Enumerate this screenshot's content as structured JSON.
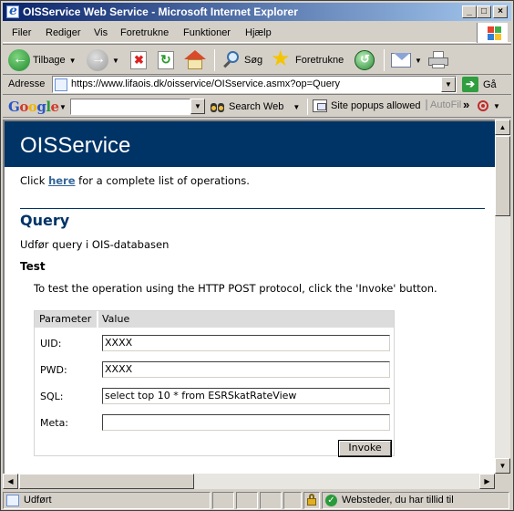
{
  "window": {
    "title": "OISService Web Service - Microsoft Internet Explorer",
    "controls": [
      "_",
      "□",
      "×"
    ]
  },
  "menu": [
    {
      "label": "Filer"
    },
    {
      "label": "Rediger"
    },
    {
      "label": "Vis"
    },
    {
      "label": "Foretrukne"
    },
    {
      "label": "Funktioner"
    },
    {
      "label": "Hjælp"
    }
  ],
  "toolbar": {
    "back_label": "Tilbage",
    "search_label": "Søg",
    "favorites_label": "Foretrukne"
  },
  "address": {
    "label": "Adresse",
    "url": "https://www.lifaois.dk/oisservice/OISservice.asmx?op=Query",
    "go_label": "Gå"
  },
  "google": {
    "logo": "Google",
    "search_value": "",
    "search_web_label": "Search Web",
    "popups_label": "Site popups allowed",
    "autofill_label": "AutoFill",
    "more": "»"
  },
  "page": {
    "header_title": "OISService",
    "intro_prefix": "Click ",
    "intro_link": "here",
    "intro_suffix": " for a complete list of operations.",
    "section_title": "Query",
    "section_desc": "Udfør query i OIS-databasen",
    "test_title": "Test",
    "test_desc": "To test the operation using the HTTP POST protocol, click the 'Invoke' button.",
    "form": {
      "col_param": "Parameter",
      "col_value": "Value",
      "fields": [
        {
          "label": "UID:",
          "value": "XXXX"
        },
        {
          "label": "PWD:",
          "value": "XXXX"
        },
        {
          "label": "SQL:",
          "value": "select top 10 * from ESRSkatRateView"
        },
        {
          "label": "Meta:",
          "value": ""
        }
      ],
      "invoke_label": "Invoke"
    }
  },
  "status": {
    "left": "Udført",
    "zone": "Websteder, du har tillid til"
  },
  "colors": {
    "header_bg": "#003366",
    "link": "#336699",
    "title_gradient_start": "#0a246a"
  },
  "icons": [
    "ie-page-icon",
    "back-arrow-icon",
    "forward-arrow-icon",
    "stop-icon",
    "refresh-icon",
    "home-icon",
    "search-icon",
    "favorites-star-icon",
    "history-icon",
    "mail-icon",
    "print-icon",
    "windows-logo-icon",
    "go-arrow-icon",
    "popup-icon",
    "lock-icon",
    "trusted-zone-icon"
  ]
}
